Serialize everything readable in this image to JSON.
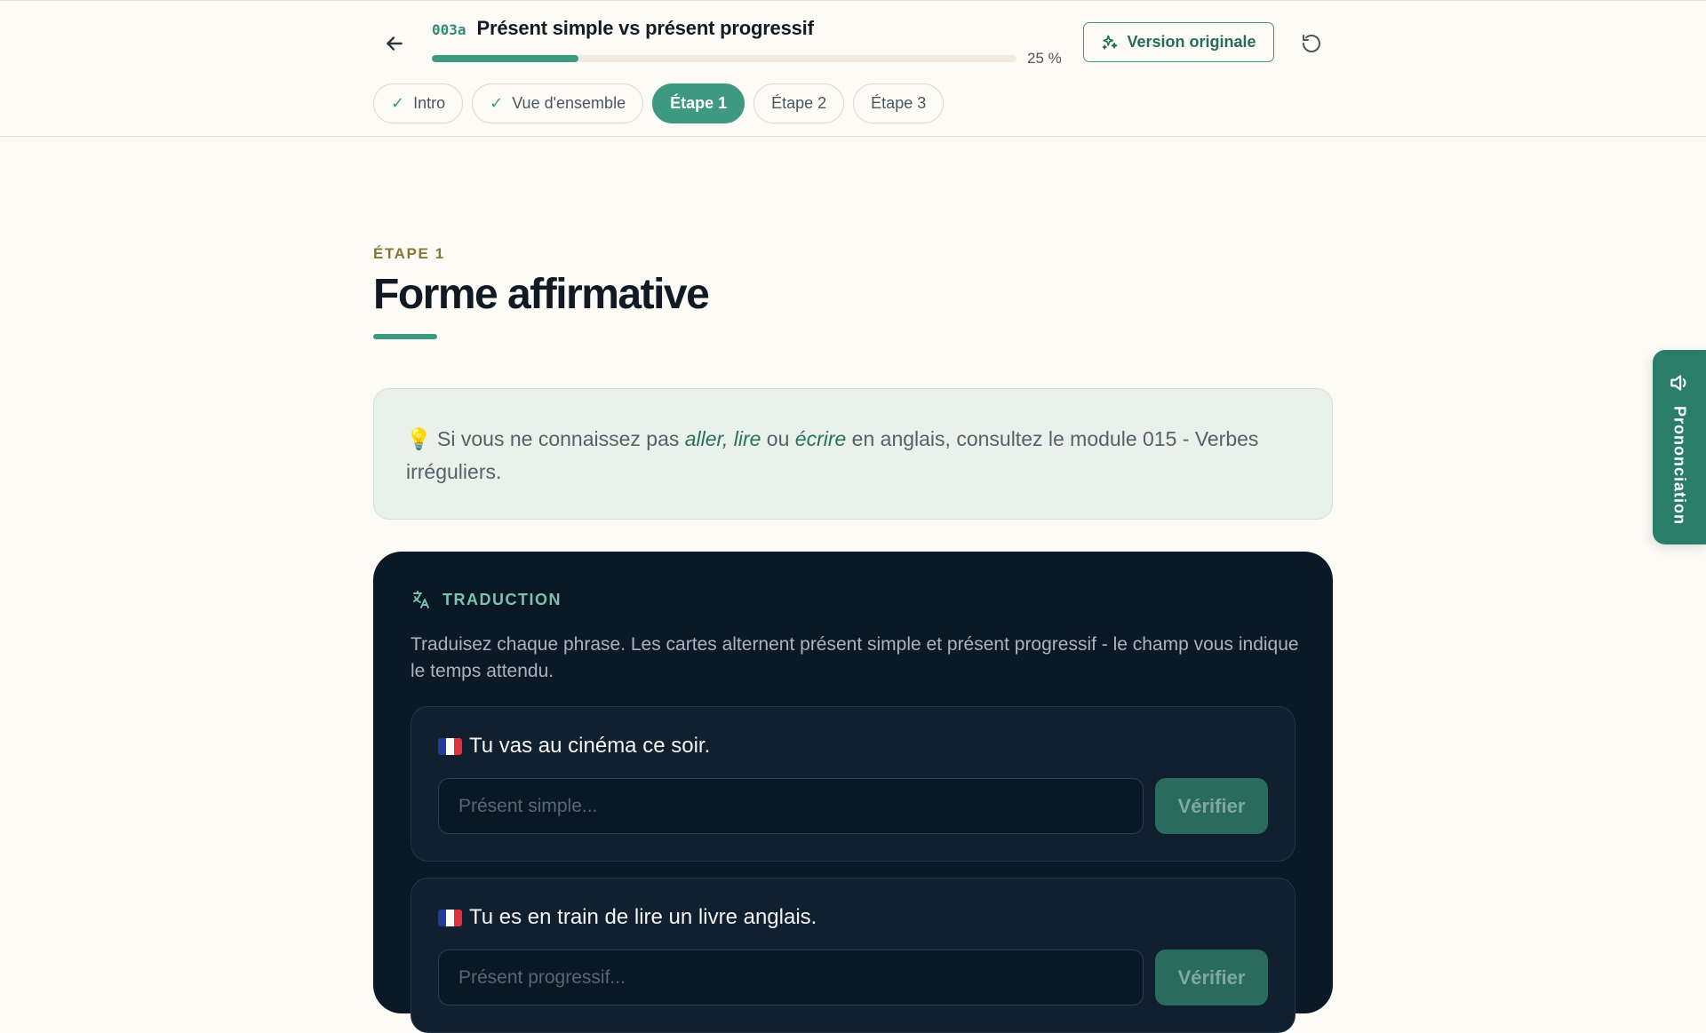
{
  "header": {
    "back_icon": "arrow-left-icon",
    "module_code": "003a",
    "module_title": "Présent simple vs présent progressif",
    "progress_percent": 25,
    "progress_label": "25 %",
    "original_version_label": "Version originale",
    "original_version_icon": "sparkles-icon",
    "reset_icon": "rotate-ccw-icon"
  },
  "tabs": [
    {
      "label": "Intro",
      "state": "done"
    },
    {
      "label": "Vue d'ensemble",
      "state": "done"
    },
    {
      "label": "Étape 1",
      "state": "active"
    },
    {
      "label": "Étape 2",
      "state": "todo"
    },
    {
      "label": "Étape 3",
      "state": "todo"
    }
  ],
  "main": {
    "step_label": "ÉTAPE 1",
    "title": "Forme affirmative"
  },
  "tip": {
    "icon": "lightbulb-emoji",
    "text_1": " Si vous ne connaissez pas ",
    "em_1": "aller, lire",
    "text_2": " ou ",
    "em_2": "écrire",
    "text_3": " en anglais, consultez le module 015 - Verbes irréguliers."
  },
  "exercise": {
    "icon": "translate-icon",
    "section_label": "TRADUCTION",
    "description": "Traduisez chaque phrase. Les cartes alternent présent simple et présent progressif - le champ vous indique le temps attendu.",
    "items": [
      {
        "prompt": "Tu vas au cinéma ce soir.",
        "placeholder": "Présent simple...",
        "value": "",
        "button": "Vérifier"
      },
      {
        "prompt": "Tu es en train de lire un livre anglais.",
        "placeholder": "Présent progressif...",
        "value": "",
        "button": "Vérifier"
      }
    ]
  },
  "side_panel": {
    "label": "Prononciation",
    "icon": "speaker-icon"
  },
  "colors": {
    "accent": "#3d9a80",
    "background": "#fdfbf6",
    "card_bg": "#0b1826",
    "step_label": "#8a7435"
  }
}
